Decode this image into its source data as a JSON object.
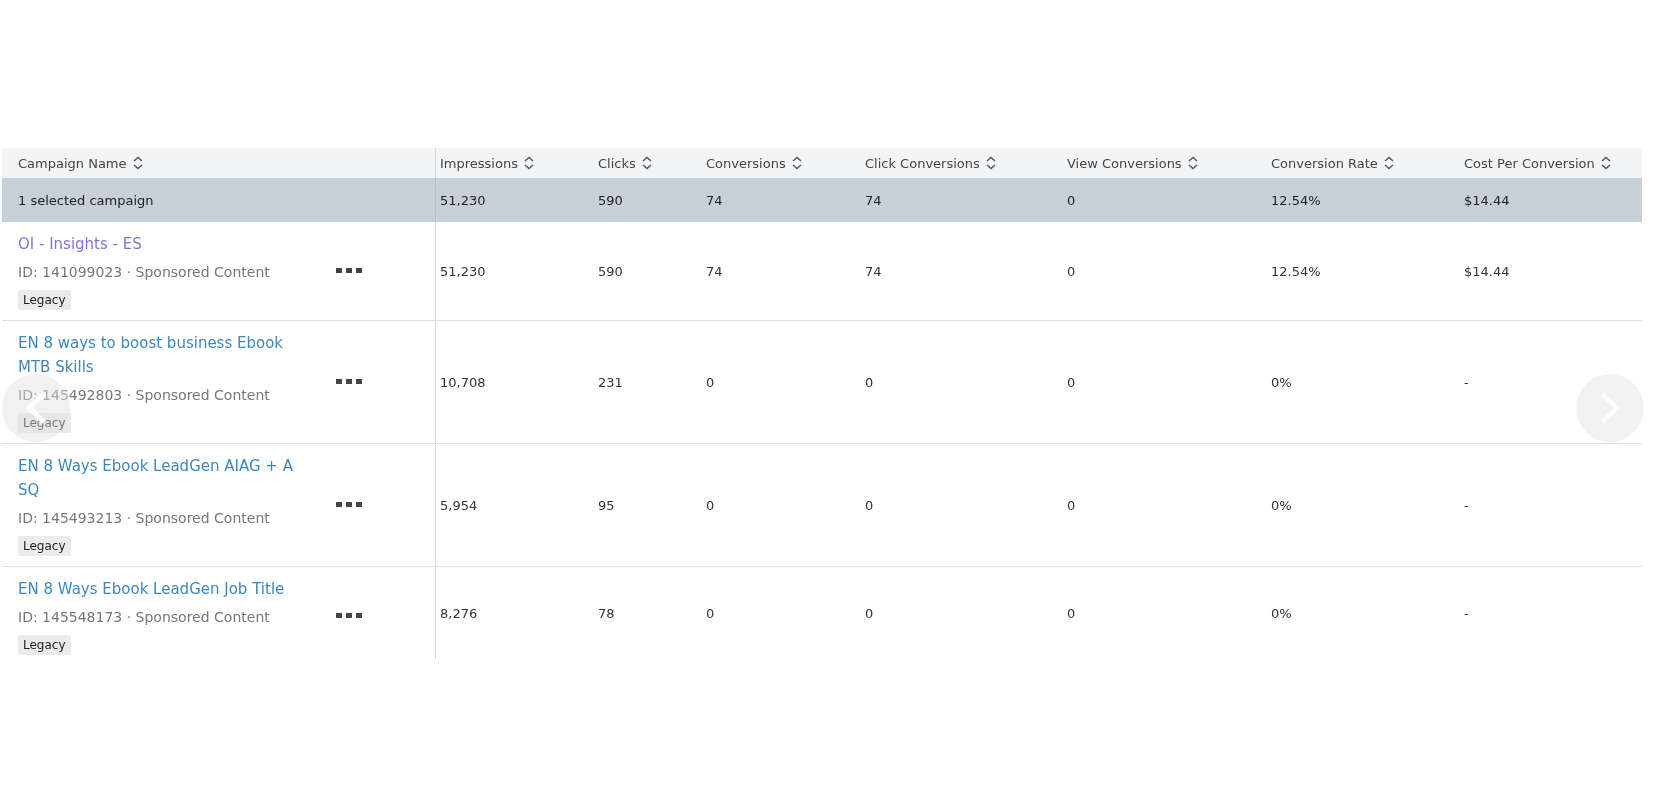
{
  "table": {
    "columns": [
      "Campaign Name",
      "Impressions",
      "Clicks",
      "Conversions",
      "Click Conversions",
      "View Conversions",
      "Conversion Rate",
      "Cost Per Conversion"
    ],
    "summary": {
      "label": "1 selected campaign",
      "values": [
        "51,230",
        "590",
        "74",
        "74",
        "0",
        "12.54%",
        "$14.44"
      ]
    },
    "rows": [
      {
        "name": "OI - Insights - ES",
        "visited": true,
        "meta": "ID: 141099023 · Sponsored Content",
        "tag": "Legacy",
        "values": [
          "51,230",
          "590",
          "74",
          "74",
          "0",
          "12.54%",
          "$14.44"
        ]
      },
      {
        "name": "EN 8 ways to boost business Ebook MTB Skills",
        "visited": false,
        "meta": "ID: 145492803 · Sponsored Content",
        "tag": "Legacy",
        "values": [
          "10,708",
          "231",
          "0",
          "0",
          "0",
          "0%",
          "-"
        ]
      },
      {
        "name": "EN 8 Ways Ebook LeadGen AIAG + ASQ",
        "visited": false,
        "meta": "ID: 145493213 · Sponsored Content",
        "tag": "Legacy",
        "values": [
          "5,954",
          "95",
          "0",
          "0",
          "0",
          "0%",
          "-"
        ]
      },
      {
        "name": "EN 8 Ways Ebook LeadGen Job Title",
        "visited": false,
        "meta": "ID: 145548173 · Sponsored Content",
        "tag": "Legacy",
        "values": [
          "8,276",
          "78",
          "0",
          "0",
          "0",
          "0%",
          "-"
        ]
      }
    ]
  }
}
